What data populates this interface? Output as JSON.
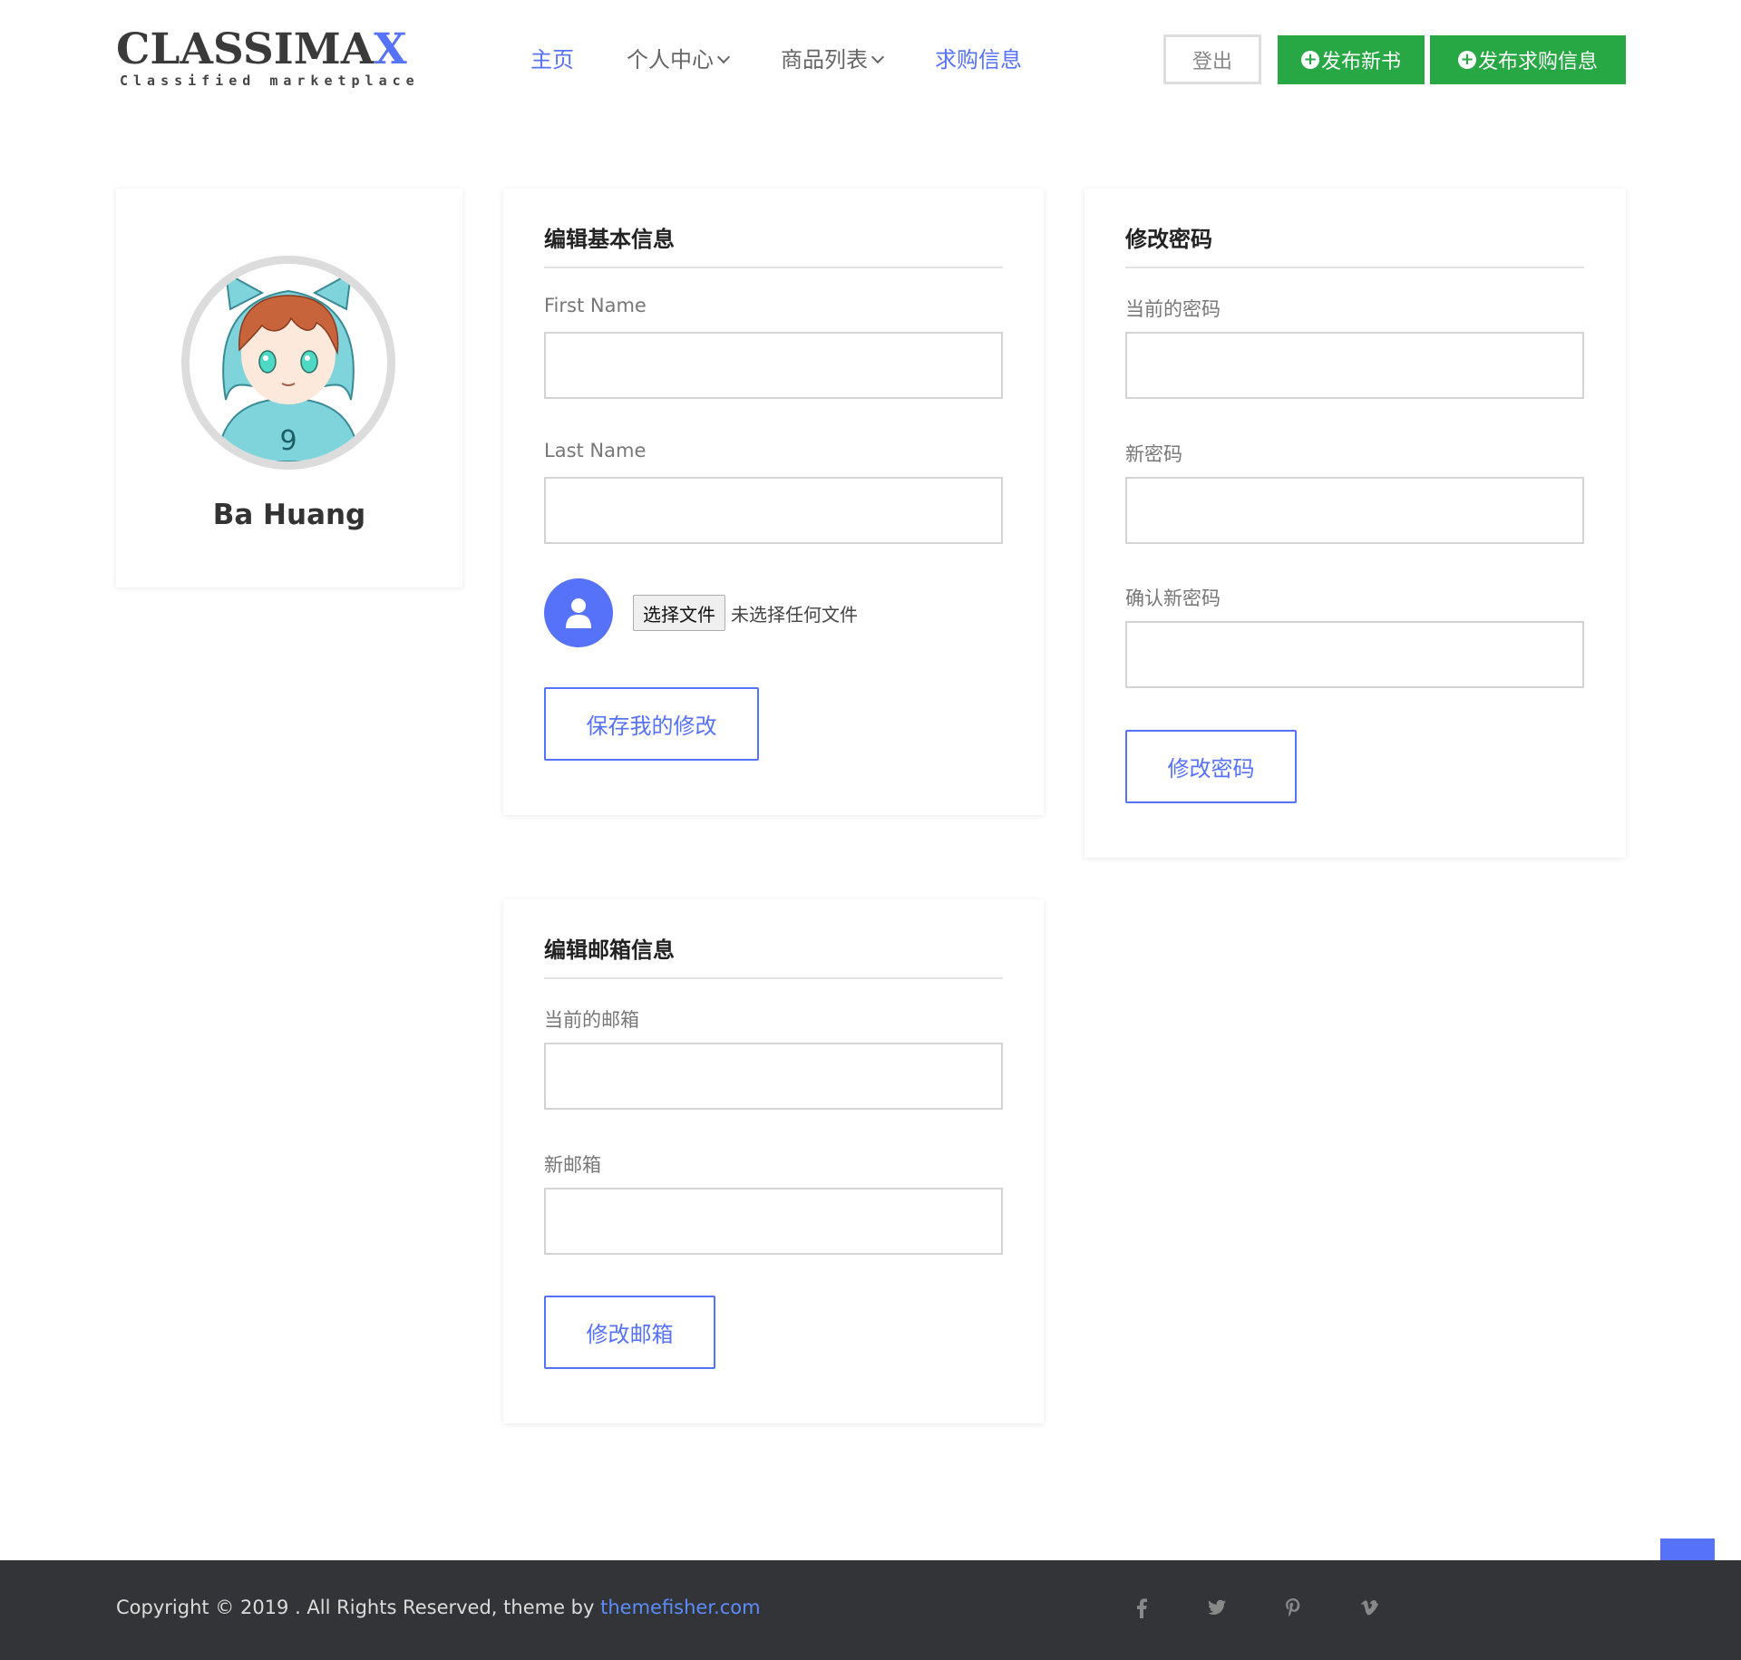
{
  "header": {
    "logo_main": "CLASSIMA",
    "logo_x": "X",
    "logo_sub": "Classified marketplace",
    "nav": [
      {
        "label": "主页",
        "active": true
      },
      {
        "label": "个人中心",
        "dropdown": true
      },
      {
        "label": "商品列表",
        "dropdown": true
      },
      {
        "label": "求购信息",
        "active": true
      }
    ],
    "logout_label": "登出",
    "publish_book_label": "发布新书",
    "publish_want_label": " 发布求购信息"
  },
  "profile": {
    "name": "Ba Huang"
  },
  "basic_info": {
    "title": "编辑基本信息",
    "first_name_label": "First Name",
    "first_name_value": "",
    "last_name_label": "Last Name",
    "last_name_value": "",
    "file_button": "选择文件",
    "file_status": "未选择任何文件",
    "save_label": "保存我的修改"
  },
  "password": {
    "title": "修改密码",
    "current_label": "当前的密码",
    "new_label": "新密码",
    "confirm_label": "确认新密码",
    "submit_label": "修改密码"
  },
  "email": {
    "title": "编辑邮箱信息",
    "current_label": "当前的邮箱",
    "new_label": "新邮箱",
    "submit_label": "修改邮箱"
  },
  "footer": {
    "copyright_prefix": "Copyright © 2019 . All Rights Reserved, theme by ",
    "copyright_link": "themefisher.com",
    "social": [
      "f",
      "t",
      "p",
      "v"
    ]
  },
  "colors": {
    "accent": "#5672f9",
    "green": "#28a745",
    "footer_bg": "#333437"
  }
}
